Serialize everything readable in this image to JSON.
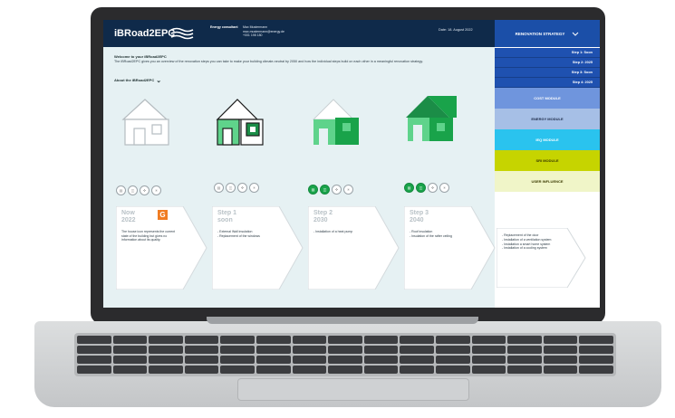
{
  "header": {
    "logo": "iBRoad2EPC",
    "consultant_label": "Energy consultant",
    "consultant_name": "Max Mustermann",
    "consultant_email": "max.mustermann@energy.de",
    "consultant_phone": "+001 198 180",
    "date": "Date: 18. August 2022"
  },
  "welcome": {
    "title": "Welcome to your iBRoad2EPC",
    "text": "The iBRoad2EPC gives you an overview of the renovation steps you can take to make your building climate-neutral by 2050 and how the individual steps build on each other in a meaningful renovation strategy.",
    "about": "About the iBRoad2EPC"
  },
  "right_panel": {
    "strategy": "RENOVATION STRATEGY",
    "steps": [
      "Step 1: Soon",
      "Step 2: 2025",
      "Step 3: Soon",
      "Step 4: 2025"
    ],
    "modules": [
      {
        "label": "COST MODULE",
        "color": "#6f95dd",
        "text_color": "#ffffff"
      },
      {
        "label": "ENERGY MODULE",
        "color": "#a6bfe6",
        "text_color": "#1e2c4a"
      },
      {
        "label": "IEQ MODULE",
        "color": "#2ac3ee",
        "text_color": "#ffffff"
      },
      {
        "label": "SRI MODULE",
        "color": "#c6d400",
        "text_color": "#3a3a00"
      },
      {
        "label": "USER INFLUENCE",
        "color": "#f0f5c8",
        "text_color": "#3a3a00"
      }
    ]
  },
  "cards": [
    {
      "title": "Now",
      "year": "2022",
      "text": "The house icon represents the current state of the building but gives no information about its quality.",
      "badge": "G"
    },
    {
      "title": "Step 1",
      "year": "soon",
      "text": "- External Wall insulation\n- Replacement of the windows"
    },
    {
      "title": "Step 2",
      "year": "2030",
      "text": "- Installation of a heat pump"
    },
    {
      "title": "Step 3",
      "year": "2040",
      "text": "- Roof insulation\n- Insulation of the rafter ceiling"
    }
  ],
  "side_card": {
    "text": "- Replacement of the door\n- Installation of a ventilation system\n- Installation a smart home system\n- Installation of a cooling system"
  },
  "colors": {
    "header_bg": "#0f2a4a",
    "content_bg": "#e6f1f3",
    "green": "#19a34a",
    "light_green": "#5fd38b"
  }
}
